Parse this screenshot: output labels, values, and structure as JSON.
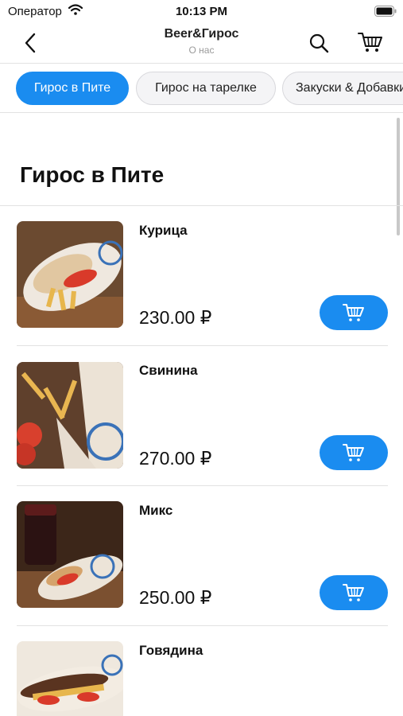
{
  "status_bar": {
    "carrier": "Оператор",
    "time": "10:13 PM"
  },
  "header": {
    "title": "Beer&Гирос",
    "subtitle": "О нас"
  },
  "categories": [
    {
      "label": "Гирос в Пите",
      "active": true
    },
    {
      "label": "Гирос на тарелке",
      "active": false
    },
    {
      "label": "Закуски & Добавки",
      "active": false
    }
  ],
  "section": {
    "title": "Гирос в Пите"
  },
  "items": [
    {
      "name": "Курица",
      "price": "230.00 ₽"
    },
    {
      "name": "Свинина",
      "price": "270.00 ₽"
    },
    {
      "name": "Микс",
      "price": "250.00 ₽"
    },
    {
      "name": "Говядина",
      "price": ""
    }
  ],
  "colors": {
    "accent": "#1a8cf0",
    "divider": "#e2e2e2",
    "chip_inactive_bg": "#f4f4f6"
  },
  "icons": [
    "wifi-icon",
    "battery-icon",
    "back-chevron-icon",
    "search-icon",
    "cart-icon",
    "add-to-cart-icon"
  ]
}
